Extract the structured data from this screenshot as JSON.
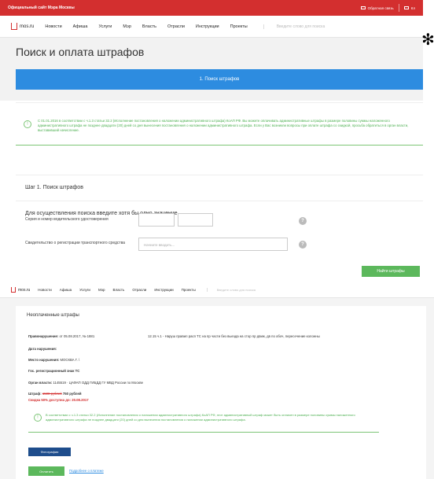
{
  "topbar": {
    "site": "Официальный сайт Мэра Москвы",
    "feedback": "Обратная связь",
    "lang": "Кл"
  },
  "nav": {
    "logo": "mos.ru",
    "items": [
      "Новости",
      "Афиша",
      "Услуги",
      "Мэр",
      "Власть",
      "Отрасли",
      "Инструкции",
      "Проекты"
    ],
    "search_placeholder": "Введите слово для поиска"
  },
  "page": {
    "title": "Поиск и оплата штрафов",
    "step_banner": "1. Поиск штрафов",
    "alert": "С 01.01.2016 в соответствии с ч.1.3 статьи 32.2 (Исполнение постановления о наложении административного штрафа) КоАП РФ. Вы можете оплачивать административные штрафы в размере половины суммы наложенного административного штрафа не позднее двадцати (20) дней со дня вынесения постановления о наложении административного штрафа. Если у Вас возникли вопросы при оплате штрафа со скидкой, просьба обратиться в орган власти, выставивший начисление.",
    "step_title": "Шаг 1. Поиск штрафов",
    "search_hint": "Для осуществления поиска введите хотя бы одно значение",
    "license_label": "Серия и номер водительского удостоверения",
    "registration_label": "Свидетельство о регистрации транспортного средства",
    "registration_placeholder": "Начните вводить...",
    "help": "?",
    "find_button": "Найти штрафы"
  },
  "results": {
    "title": "Неоплаченные штрафы",
    "violation_label": "Правонарушение:",
    "violation_ref": "от 05.08.2017, № 1881",
    "violation_text": "12.15 ч.1 - Наруш правил расп ТС на пр части без выезда на стор пр движ, дв по обоч, пересечение колонны",
    "date_label": "Дата нарушения:",
    "place_label": "Место нарушения:",
    "place_value": "МОСКВА Г. \\",
    "plate_label": "Гос. регистрационный знак ТС",
    "authority_label": "Орган власти:",
    "authority_value": "1145519 · ЦАФАП ОДД ГИБДД ГУ МВД России по Москве",
    "fine_label": "Штраф:",
    "fine_old": "1500 рублей",
    "fine_new": "750 рублей",
    "discount": "Скидка 50% доступна до: 20.08.2017",
    "alert": "В соответствии с ч.1.3 статьи 32.2 (Исполнение постановления о наложении административного штрафа) КоАП РФ, этот административный штраф может быть оплачен в размере половины суммы наложенного административного штрафа не позднее двадцати (20) дней со дня вынесения постановления о наложении административного штрафа.",
    "photos_button": "Фотографии",
    "pay_button": "Оплатить",
    "details_link": "Подробнее о платеже"
  }
}
